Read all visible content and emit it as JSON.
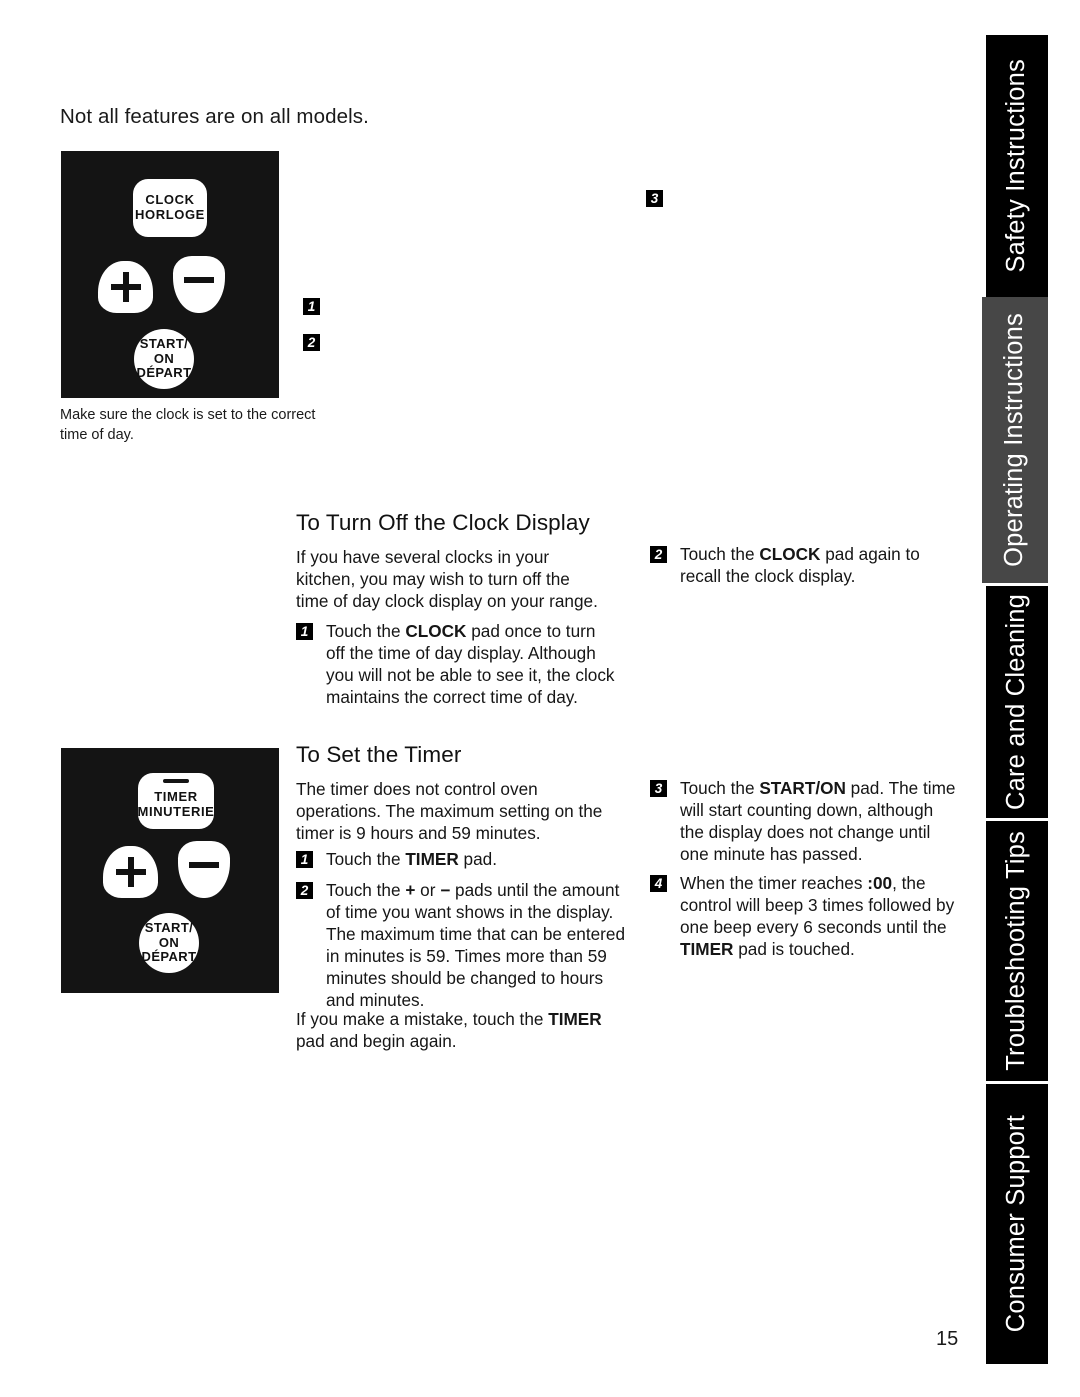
{
  "page": {
    "number": "15",
    "intro_note": "Not all features are on all models."
  },
  "sidebar": {
    "tabs": [
      {
        "label": "Safety Instructions",
        "active": false
      },
      {
        "label": "Operating Instructions",
        "active": true
      },
      {
        "label": "Care and Cleaning",
        "active": false
      },
      {
        "label": "Troubleshooting Tips",
        "active": false
      },
      {
        "label": "Consumer Support",
        "active": false
      }
    ]
  },
  "control_panel_clock": {
    "caption": "Make sure the clock is set to the correct time of day.",
    "pads": {
      "clock": {
        "line1": "CLOCK",
        "line2": "HORLOGE"
      },
      "plus": "+",
      "minus": "−",
      "start": {
        "line1": "START/",
        "line2": "ON",
        "line3": "DÉPART"
      }
    },
    "callouts": [
      {
        "num": "1"
      },
      {
        "num": "2"
      },
      {
        "num": "3"
      }
    ]
  },
  "control_panel_timer": {
    "pads": {
      "timer": {
        "line1": "TIMER",
        "line2": "MINUTERIE"
      },
      "plus": "+",
      "minus": "−",
      "start": {
        "line1": "START/",
        "line2": "ON",
        "line3": "DÉPART"
      }
    }
  },
  "clock_display_section": {
    "heading": "To Turn Off the Clock Display",
    "intro": "If you have several clocks in your kitchen, you may wish to turn off the time of day clock display on your range.",
    "steps": [
      {
        "num": "1",
        "text_before": "Touch the ",
        "bold": "CLOCK",
        "text_after": " pad once to turn off the time of day display. Although you will not be able to see it, the clock maintains the correct time of day."
      },
      {
        "num": "2",
        "text_before": "Touch the ",
        "bold": "CLOCK",
        "text_after": " pad again to recall the clock display."
      }
    ]
  },
  "timer_section": {
    "heading": "To Set the Timer",
    "intro": "The timer does not control oven operations. The maximum setting on the timer is 9 hours and 59 minutes.",
    "step1": {
      "num": "1",
      "text_before": "Touch the ",
      "bold": "TIMER",
      "text_after": " pad."
    },
    "step2": {
      "num": "2",
      "text_before": "Touch the ",
      "bold_a": "+",
      "text_mid": " or ",
      "bold_b": "−",
      "text_after": " pads until the amount of time you want shows in the display. The maximum time that can be entered in minutes is 59. Times more than 59 minutes should be changed to hours and minutes."
    },
    "step3": {
      "num": "3",
      "text_before": "Touch the ",
      "bold": "START/ON",
      "text_after": " pad. The time will start counting down, although the display does not change until one minute has passed."
    },
    "step4": {
      "num": "4",
      "text_before": "When the timer reaches ",
      "bold_a": ":00",
      "text_mid": ", the control will beep 3 times followed by one beep every 6 seconds until the ",
      "bold_b": "TIMER",
      "text_after": " pad is touched."
    },
    "mistake_note": {
      "text_before": "If you make a mistake, touch the ",
      "bold": "TIMER",
      "text_after": " pad and begin again."
    }
  }
}
